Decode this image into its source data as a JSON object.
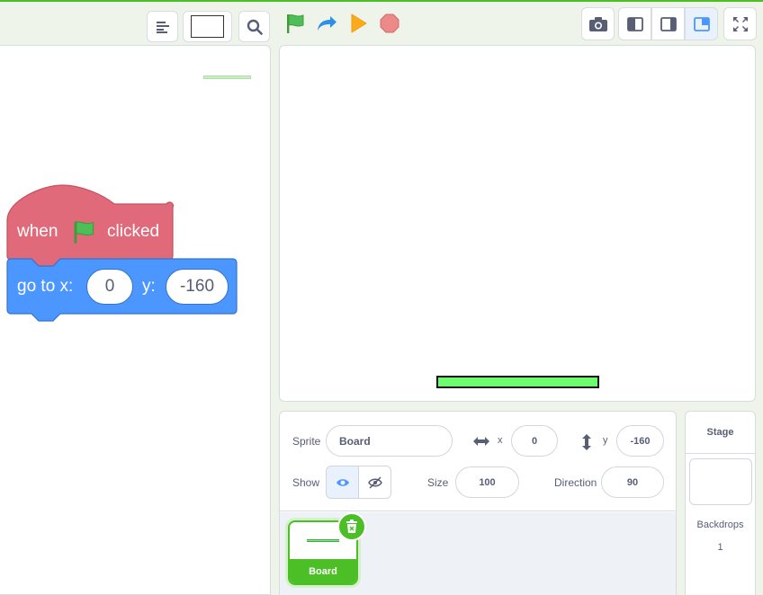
{
  "toolbar": {
    "project_title_value": "",
    "search_icon": "search-icon",
    "align_icon": "align-icon",
    "flag_icon": "green-flag-icon",
    "turbo_icon": "turbo-arrow-icon",
    "go_icon": "go-triangle-icon",
    "stop_icon": "stop-icon",
    "screenshot_icon": "camera-icon",
    "layout_icons": [
      "small-stage-icon",
      "normal-stage-icon",
      "large-stage-icon"
    ],
    "fullscreen_icon": "fullscreen-icon"
  },
  "code": {
    "hat_block": {
      "word_when": "when",
      "word_clicked": "clicked",
      "flag_icon": "green-flag-icon"
    },
    "motion_block": {
      "label_x": "go to x:",
      "value_x": "0",
      "label_y": "y:",
      "value_y": "-160"
    }
  },
  "sprite_info": {
    "sprite_label": "Sprite",
    "sprite_name": "Board",
    "x_label": "x",
    "x_value": "0",
    "y_label": "y",
    "y_value": "-160",
    "show_label": "Show",
    "size_label": "Size",
    "size_value": "100",
    "direction_label": "Direction",
    "direction_value": "90"
  },
  "sprites": [
    {
      "name": "Board",
      "selected": true
    }
  ],
  "stage_panel": {
    "title": "Stage",
    "backdrops_label": "Backdrops",
    "backdrops_count": "1"
  },
  "colors": {
    "accent_green": "#4cbf27",
    "event_block": "#e0697a",
    "motion_block": "#4c97ff",
    "paddle": "#6dfc6d"
  }
}
